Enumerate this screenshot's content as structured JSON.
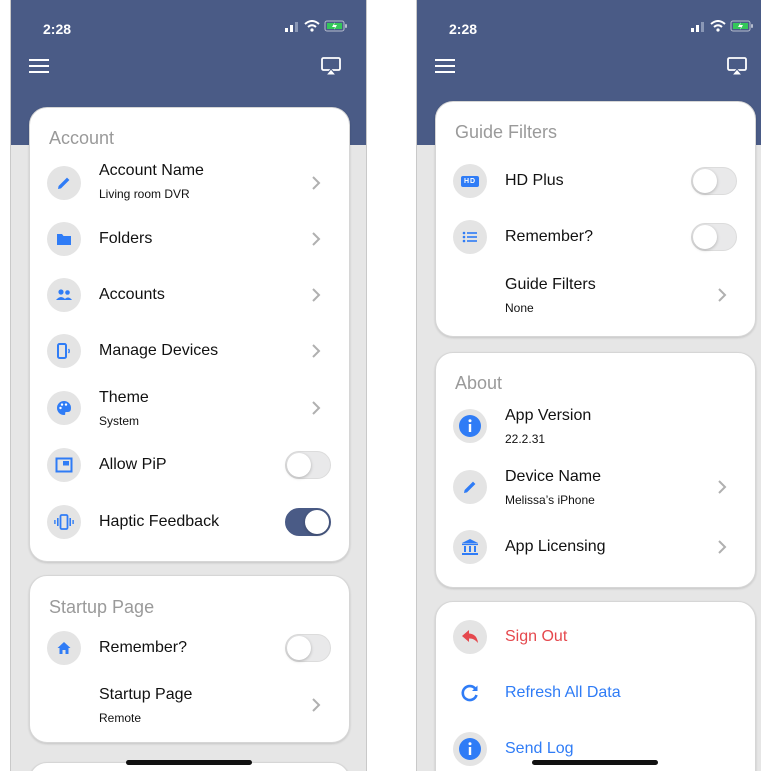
{
  "status_bar": {
    "time": "2:28"
  },
  "left": {
    "account": {
      "title": "Account",
      "account_name": {
        "label": "Account Name",
        "value": "Living room DVR"
      },
      "folders": {
        "label": "Folders"
      },
      "accounts": {
        "label": "Accounts"
      },
      "manage_devices": {
        "label": "Manage Devices"
      },
      "theme": {
        "label": "Theme",
        "value": "System"
      },
      "allow_pip": {
        "label": "Allow PiP",
        "on": false
      },
      "haptic": {
        "label": "Haptic Feedback",
        "on": true
      }
    },
    "startup": {
      "title": "Startup Page",
      "remember": {
        "label": "Remember?",
        "on": false
      },
      "startup_page": {
        "label": "Startup Page",
        "value": "Remote"
      }
    }
  },
  "right": {
    "guide_filters": {
      "title": "Guide Filters",
      "hd_plus": {
        "label": "HD Plus",
        "on": false,
        "badge": "HD"
      },
      "remember": {
        "label": "Remember?",
        "on": false
      },
      "filters": {
        "label": "Guide Filters",
        "value": "None"
      }
    },
    "about": {
      "title": "About",
      "app_version": {
        "label": "App Version",
        "value": "22.2.31"
      },
      "device_name": {
        "label": "Device Name",
        "value": "Melissa’s iPhone"
      },
      "licensing": {
        "label": "App Licensing"
      }
    },
    "actions": {
      "sign_out": "Sign Out",
      "refresh": "Refresh All Data",
      "send_log": "Send Log"
    }
  },
  "colors": {
    "header": "#4a5b86",
    "accent_blue": "#2f7cf6",
    "danger_red": "#e5484d",
    "toggle_on": "#4a5b86"
  }
}
